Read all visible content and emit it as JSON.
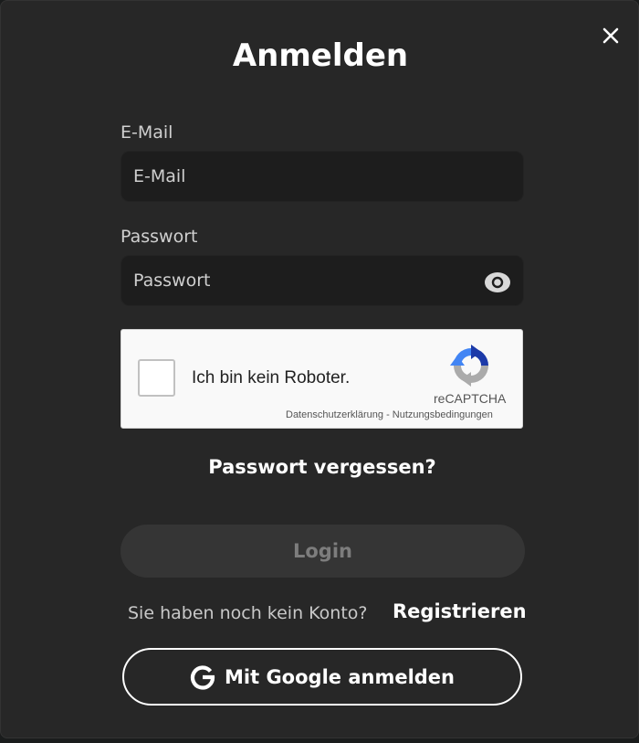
{
  "modal": {
    "title": "Anmelden",
    "close_icon": "close-icon"
  },
  "email": {
    "label": "E-Mail",
    "placeholder": "E-Mail",
    "value": ""
  },
  "password": {
    "label": "Passwort",
    "placeholder": "Passwort",
    "value": "",
    "toggle_icon": "eye-icon"
  },
  "recaptcha": {
    "checkbox_label": "Ich bin kein Roboter.",
    "checked": false,
    "brand": "reCAPTCHA",
    "privacy": "Datenschutzerklärung",
    "separator": " - ",
    "terms": "Nutzungsbedingungen",
    "logo_icon": "recaptcha-logo-icon"
  },
  "forgot_password": "Passwort vergessen?",
  "login_button": "Login",
  "signup": {
    "prompt": "Sie haben noch kein Konto?",
    "link": "Registrieren"
  },
  "google_button": {
    "label": "Mit Google anmelden",
    "icon": "google-g-icon"
  },
  "colors": {
    "modal_bg": "#272727",
    "input_bg": "#1d1d1d",
    "login_bg": "#353535",
    "login_text": "#7d7d7d",
    "text": "#ffffff"
  }
}
